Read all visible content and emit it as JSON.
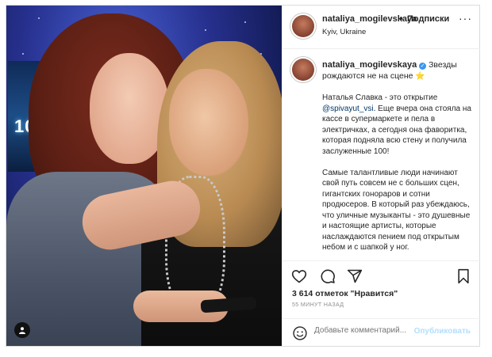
{
  "header": {
    "username": "nataliya_mogilevskaya",
    "separator": "•",
    "follow_label": "Подписки",
    "location": "Kyiv, Ukraine",
    "more_label": "···"
  },
  "photo": {
    "screen_text": "100"
  },
  "caption": {
    "username": "nataliya_mogilevskaya",
    "headline": "Звезды рождаются не на сцене",
    "star": "⭐",
    "p1_before": "Наталья Славка - это открытие ",
    "p1_mention": "@spivayut_vsi",
    "p1_after": ". Еще вчера она стояла на кассе в супермаркете и пела в электричках, а сегодня она фаворитка, которая подняла всю стену и получила заслуженные 100!",
    "p2": "Самые талантливые люди начинают свой путь совсем не с больших сцен, гигантских гонораров и сотни продюсеров. В который раз убеждаюсь, что уличные музыканты - это душевные и настоящие артисты, которые наслаждаются пением под открытым небом и с шапкой у ног."
  },
  "actions": {
    "icons": [
      "heart-icon",
      "comment-icon",
      "share-icon",
      "bookmark-icon"
    ]
  },
  "likes": {
    "text": "3 614 отметок \"Нравится\""
  },
  "timestamp": "55 МИНУТ НАЗАД",
  "comment": {
    "placeholder": "Добавьте комментарий...",
    "post_label": "Опубликовать"
  },
  "colors": {
    "link": "#00376b",
    "verified": "#3897f0",
    "post_disabled": "#b2dffc"
  }
}
